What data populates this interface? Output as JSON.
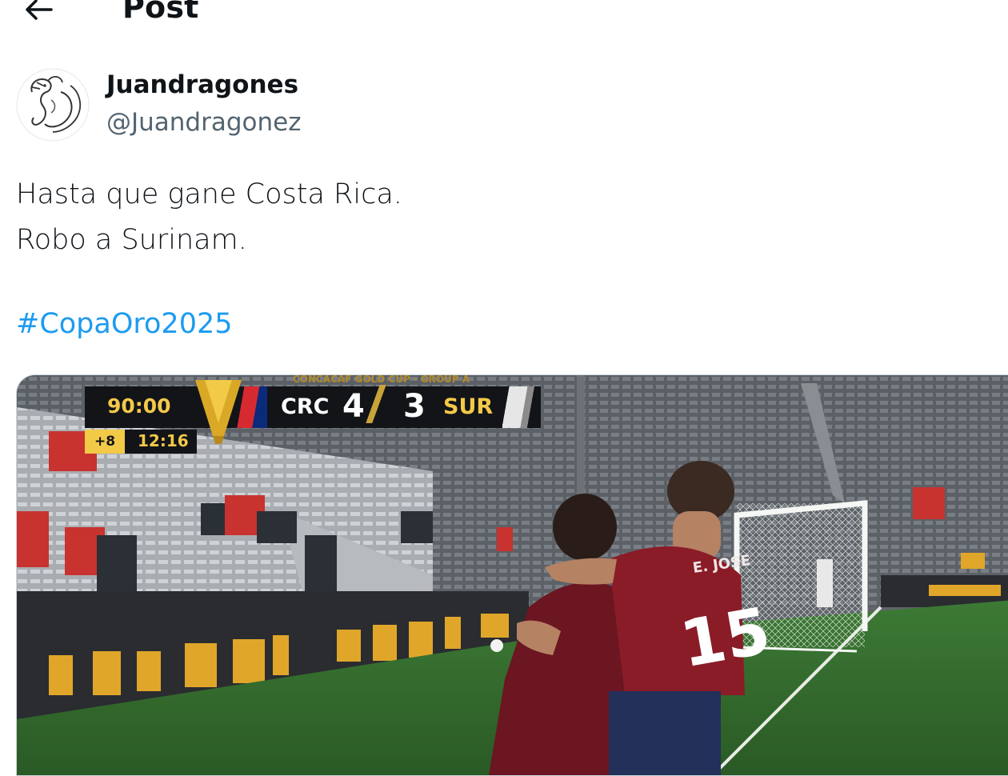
{
  "header": {
    "title": "Post",
    "back_icon": "arrow-left-icon"
  },
  "author": {
    "display_name": "Juandragones",
    "handle": "@Juandragonez",
    "avatar_icon": "dragon-logo-icon"
  },
  "tweet": {
    "lines": [
      "Hasta que gane Costa Rica.",
      "Robo a Surinam."
    ],
    "hashtag": "#CopaOro2025",
    "hashtag_color": "#1d9bf0"
  },
  "media": {
    "scorebug": {
      "competition": "CONCACAF GOLD CUP · GROUP A",
      "match_time": "90:00",
      "added_time": "+8",
      "clock": "12:16",
      "home_team": "CRC",
      "home_score": "4",
      "away_team": "SUR",
      "away_score": "3"
    },
    "jersey_number": "15",
    "jersey_name": "E. JOSE"
  }
}
